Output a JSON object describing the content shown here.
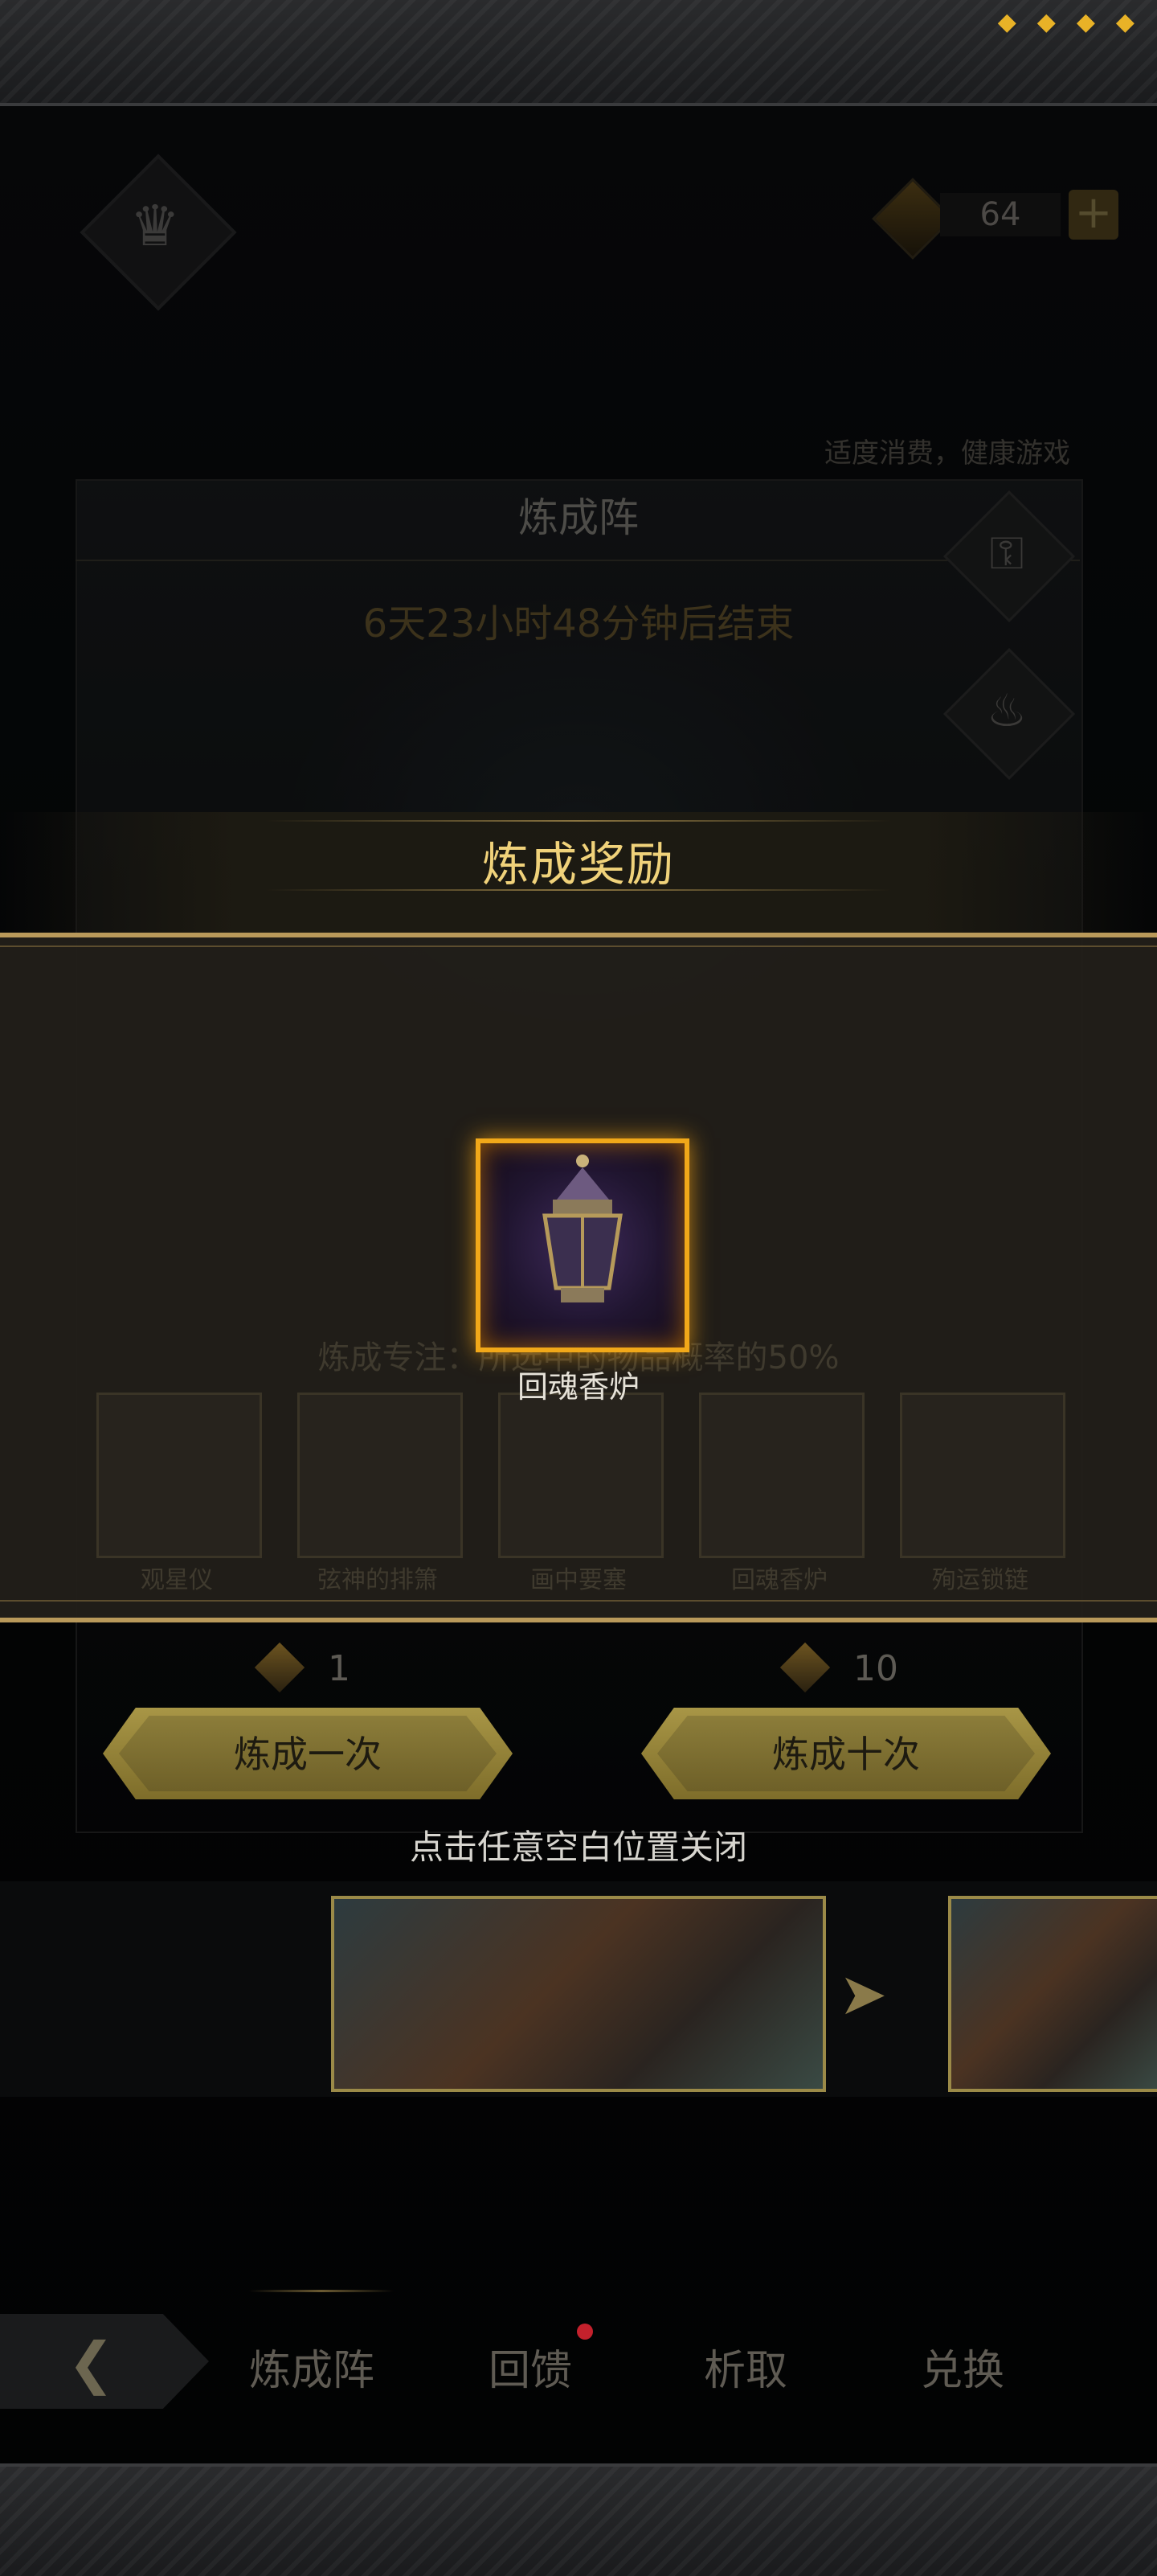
{
  "top_bar": {
    "status_icons": [
      "duck-icon",
      "duck-icon",
      "duck-icon",
      "duck-icon"
    ]
  },
  "header": {
    "currency_count": "64",
    "currency_plus": "+",
    "health_note": "适度消费，健康游戏"
  },
  "panel": {
    "title": "炼成阵",
    "timer": "6天23小时48分钟后结束"
  },
  "modal": {
    "title": "炼成奖励",
    "reward_name": "回魂香炉",
    "close_hint": "点击任意空白位置关闭"
  },
  "background_hint": {
    "focus_text": "炼成专注：所选中的物品概率的50%",
    "card_labels": [
      "观星仪",
      "弦神的排箫",
      "画中要塞",
      "回魂香炉",
      "殉运锁链"
    ]
  },
  "draw": {
    "single": {
      "cost": "1",
      "label": "炼成一次"
    },
    "ten": {
      "cost": "10",
      "label": "炼成十次"
    }
  },
  "bottom_nav": {
    "items": [
      "炼成阵",
      "回馈",
      "析取",
      "兑换"
    ]
  }
}
